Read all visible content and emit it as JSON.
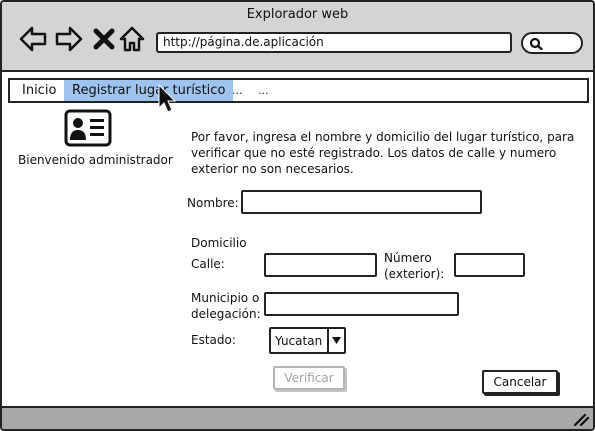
{
  "window": {
    "title": "Explorador web",
    "url": "http://página.de.aplicación"
  },
  "icons": {
    "back": "arrow-left-icon",
    "forward": "arrow-right-icon",
    "close": "x-close-icon",
    "home": "home-icon",
    "search": "search-icon",
    "profile": "id-card-icon",
    "cursor": "mouse-pointer-icon",
    "grip": "resize-grip-icon"
  },
  "menu": {
    "items": [
      "Inicio",
      "Registrar lugar turístico",
      "...",
      "..."
    ],
    "active_index": 1
  },
  "sidebar": {
    "welcome": "Bienvenido administrador"
  },
  "form": {
    "instructions": "Por favor, ingresa el nombre y domicilio del lugar turístico, para verificar que no esté registrado. Los datos de calle y numero exterior no son necesarios.",
    "nombre_label": "Nombre:",
    "nombre_value": "",
    "domicilio_label": "Domicilio",
    "calle_label": "Calle:",
    "calle_value": "",
    "numero_label": "Número (exterior):",
    "numero_value": "",
    "municipio_label": "Municipio o delegación:",
    "municipio_value": "",
    "estado_label": "Estado:",
    "estado_value": "Yucatan"
  },
  "buttons": {
    "verificar": "Verificar",
    "cancelar": "Cancelar"
  },
  "colors": {
    "chrome": "#d4d4d4",
    "active_menu": "#9ec3ef",
    "status_bar": "#a8a8a8",
    "disabled_text": "#a3a3a3"
  }
}
